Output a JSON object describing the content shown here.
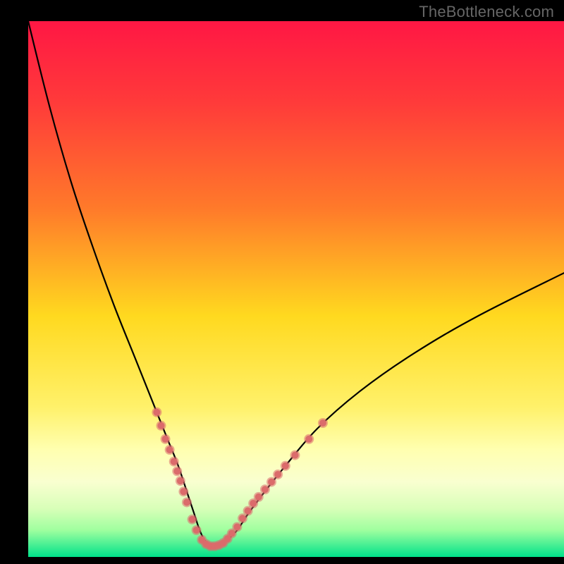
{
  "watermark": "TheBottleneck.com",
  "chart_data": {
    "type": "line",
    "title": "",
    "xlabel": "",
    "ylabel": "",
    "xlim": [
      0,
      100
    ],
    "ylim": [
      0,
      100
    ],
    "gradient_stops": [
      {
        "offset": 0.0,
        "color": "#ff1744"
      },
      {
        "offset": 0.15,
        "color": "#ff3a3a"
      },
      {
        "offset": 0.35,
        "color": "#ff7a2a"
      },
      {
        "offset": 0.55,
        "color": "#ffd91f"
      },
      {
        "offset": 0.72,
        "color": "#fff16a"
      },
      {
        "offset": 0.8,
        "color": "#ffffb0"
      },
      {
        "offset": 0.86,
        "color": "#f9ffd0"
      },
      {
        "offset": 0.91,
        "color": "#d8ffb8"
      },
      {
        "offset": 0.95,
        "color": "#9fff9f"
      },
      {
        "offset": 1.0,
        "color": "#00e28a"
      }
    ],
    "series": [
      {
        "name": "bottleneck-curve",
        "x": [
          0,
          4,
          8,
          12,
          16,
          20,
          24,
          26,
          28,
          30,
          31,
          32,
          33,
          34,
          35,
          36,
          37,
          39,
          41,
          44,
          48,
          54,
          62,
          72,
          84,
          100
        ],
        "y": [
          100,
          84,
          70,
          58,
          47,
          37,
          27,
          22,
          17,
          11,
          8,
          5,
          3,
          2,
          2,
          2,
          3,
          5,
          8,
          12,
          17,
          24,
          31,
          38,
          45,
          53
        ]
      }
    ],
    "markers": {
      "name": "highlight-points",
      "color": "#db6b6b",
      "radius_outer": 7,
      "radius_inner": 5,
      "points": [
        {
          "x": 24.0,
          "y": 27.0
        },
        {
          "x": 24.8,
          "y": 24.5
        },
        {
          "x": 25.6,
          "y": 22.0
        },
        {
          "x": 26.4,
          "y": 20.0
        },
        {
          "x": 27.2,
          "y": 17.8
        },
        {
          "x": 27.8,
          "y": 16.0
        },
        {
          "x": 28.4,
          "y": 14.2
        },
        {
          "x": 29.0,
          "y": 12.2
        },
        {
          "x": 29.6,
          "y": 10.2
        },
        {
          "x": 30.6,
          "y": 7.0
        },
        {
          "x": 31.4,
          "y": 5.0
        },
        {
          "x": 32.4,
          "y": 3.2
        },
        {
          "x": 33.2,
          "y": 2.4
        },
        {
          "x": 34.0,
          "y": 2.0
        },
        {
          "x": 34.8,
          "y": 2.0
        },
        {
          "x": 35.6,
          "y": 2.2
        },
        {
          "x": 36.4,
          "y": 2.6
        },
        {
          "x": 37.2,
          "y": 3.4
        },
        {
          "x": 38.0,
          "y": 4.4
        },
        {
          "x": 39.0,
          "y": 5.6
        },
        {
          "x": 40.0,
          "y": 7.2
        },
        {
          "x": 41.0,
          "y": 8.6
        },
        {
          "x": 42.0,
          "y": 10.0
        },
        {
          "x": 43.0,
          "y": 11.2
        },
        {
          "x": 44.2,
          "y": 12.6
        },
        {
          "x": 45.4,
          "y": 14.0
        },
        {
          "x": 46.6,
          "y": 15.4
        },
        {
          "x": 48.0,
          "y": 17.0
        },
        {
          "x": 49.8,
          "y": 19.0
        },
        {
          "x": 52.4,
          "y": 22.0
        },
        {
          "x": 55.0,
          "y": 25.0
        }
      ]
    }
  }
}
